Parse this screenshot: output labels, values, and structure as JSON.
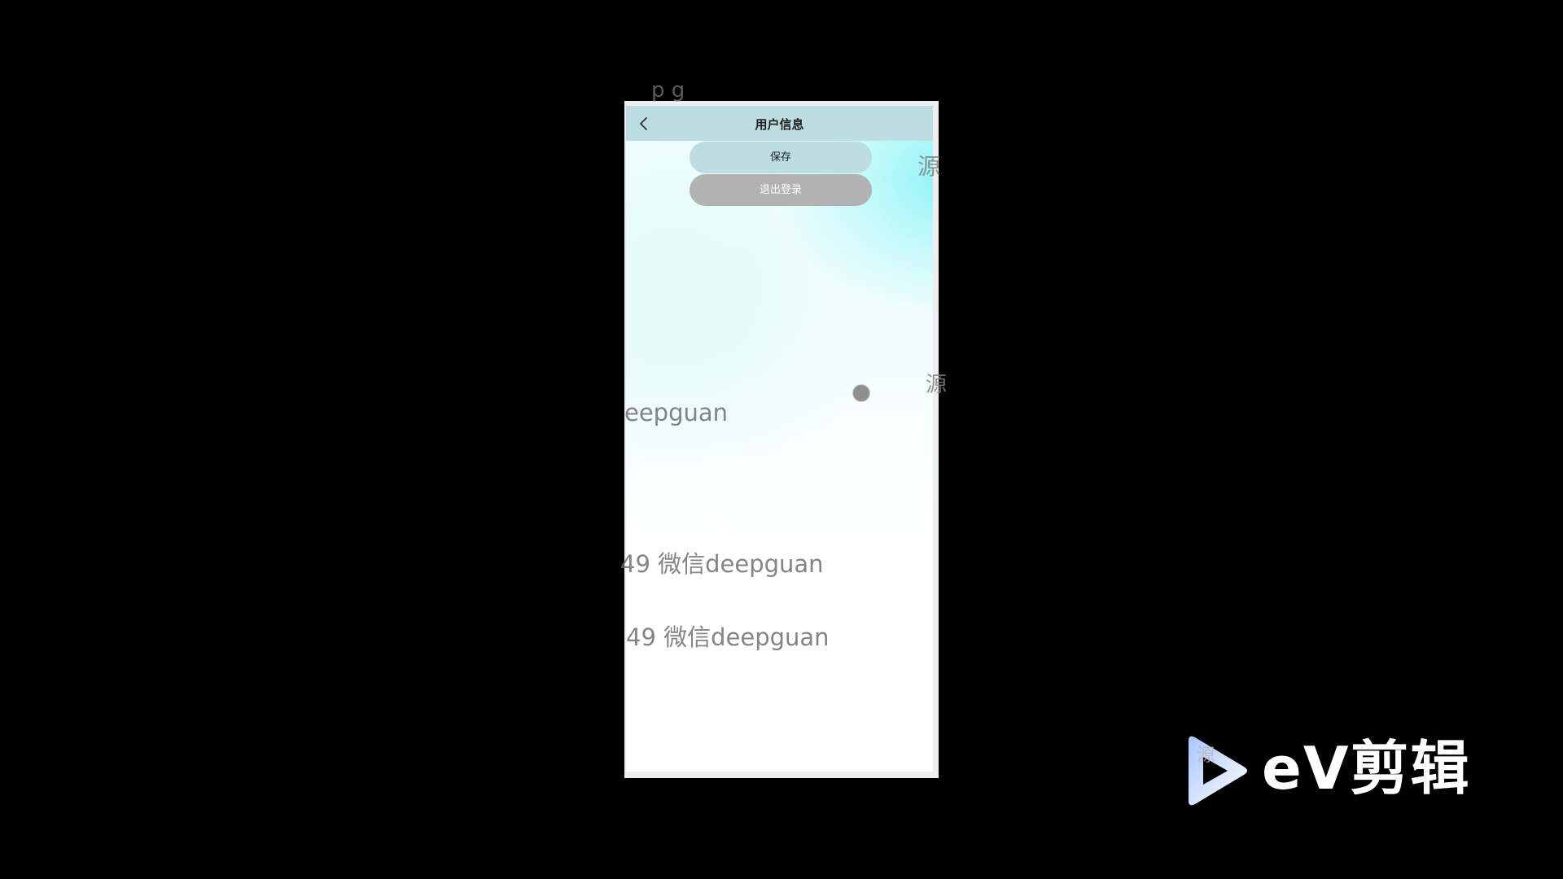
{
  "header": {
    "title": "用户信息",
    "back_icon": "chevron-left-icon"
  },
  "actions": {
    "save_label": "保存",
    "logout_label": "退出登录"
  },
  "watermarks": [
    "eepguan",
    "49 微信deepguan",
    "49 微信deepguan",
    "源",
    "源",
    "p g",
    "源"
  ],
  "branding": {
    "logo_text": "eV剪辑",
    "logo_icon": "play-icon"
  },
  "colors": {
    "header_bg": "#bcdde2",
    "save_bg": "#bcdde2",
    "logout_bg": "#b2b2b2",
    "backdrop": "#000000"
  }
}
